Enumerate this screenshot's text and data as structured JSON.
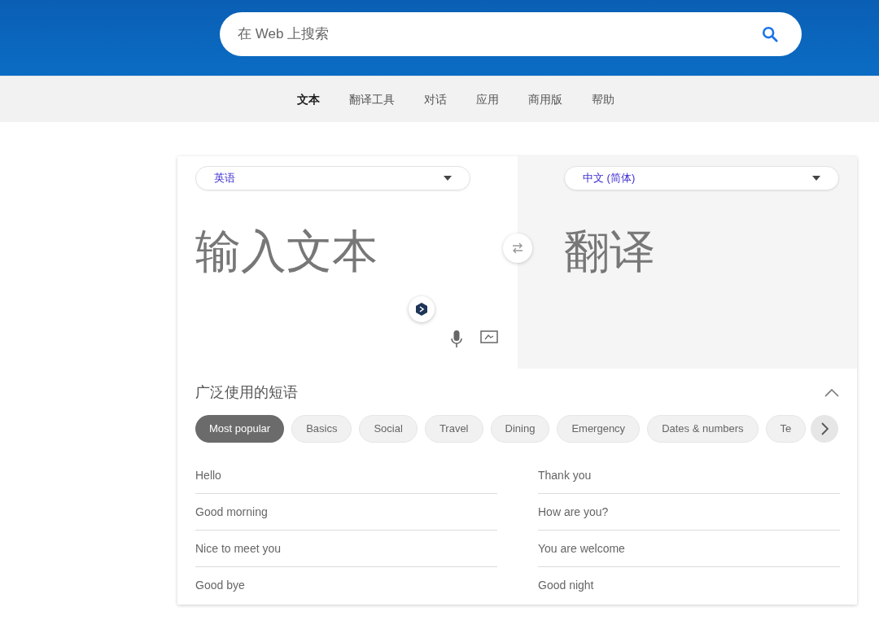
{
  "search": {
    "placeholder": "在 Web 上搜索"
  },
  "nav": [
    {
      "label": "文本",
      "selected": true
    },
    {
      "label": "翻译工具",
      "selected": false
    },
    {
      "label": "对话",
      "selected": false
    },
    {
      "label": "应用",
      "selected": false
    },
    {
      "label": "商用版",
      "selected": false
    },
    {
      "label": "帮助",
      "selected": false
    }
  ],
  "translator": {
    "source_language": "英语",
    "target_language": "中文 (简体)",
    "input": {
      "placeholder": "输入文本"
    },
    "output": {
      "placeholder": "翻译"
    }
  },
  "phrases": {
    "title": "广泛使用的短语",
    "expanded": true,
    "categories": [
      {
        "label": "Most popular",
        "selected": true
      },
      {
        "label": "Basics",
        "selected": false
      },
      {
        "label": "Social",
        "selected": false
      },
      {
        "label": "Travel",
        "selected": false
      },
      {
        "label": "Dining",
        "selected": false
      },
      {
        "label": "Emergency",
        "selected": false
      },
      {
        "label": "Dates & numbers",
        "selected": false
      },
      {
        "label": "Te",
        "selected": false
      }
    ],
    "items": [
      "Hello",
      "Thank you",
      "Good morning",
      "How are you?",
      "Nice to meet you",
      "You are welcome",
      "Good bye",
      "Good night"
    ]
  }
}
